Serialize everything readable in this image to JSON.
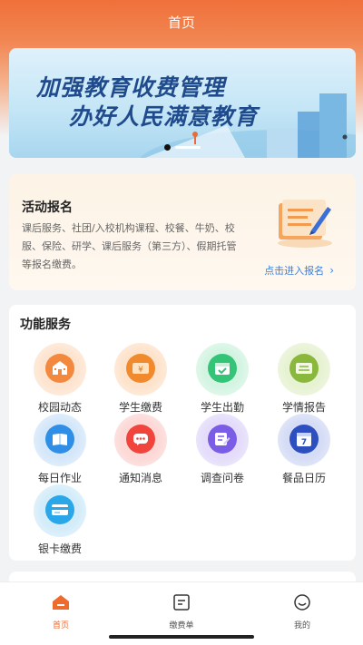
{
  "header": {
    "title": "首页"
  },
  "banner": {
    "line1": "加强教育收费管理",
    "line2": "办好人民满意教育"
  },
  "activity": {
    "title": "活动报名",
    "description": "课后服务、社团/入校机构课程、校餐、牛奶、校服、保险、研学、课后服务（第三方）、假期托管等报名缴费。",
    "link": "点击进入报名",
    "link_chevron": "›"
  },
  "services": {
    "title": "功能服务",
    "items": [
      {
        "label": "校园动态",
        "icon": "school-building-icon",
        "color": "#f2893e"
      },
      {
        "label": "学生缴费",
        "icon": "yuan-payment-icon",
        "color": "#f08a2c"
      },
      {
        "label": "学生出勤",
        "icon": "calendar-check-icon",
        "color": "#34c477"
      },
      {
        "label": "学情报告",
        "icon": "score-100-icon",
        "color": "#8ab83c"
      },
      {
        "label": "每日作业",
        "icon": "book-icon",
        "color": "#2f8fe6"
      },
      {
        "label": "通知消息",
        "icon": "message-icon",
        "color": "#f0443d"
      },
      {
        "label": "调查问卷",
        "icon": "survey-edit-icon",
        "color": "#7b5ce6"
      },
      {
        "label": "餐品日历",
        "icon": "calendar-7-icon",
        "color": "#2e4fbf"
      },
      {
        "label": "银卡缴费",
        "icon": "bank-card-icon",
        "color": "#2aa7e8"
      }
    ]
  },
  "calendar_day": "7",
  "yuan_symbol": "¥",
  "tabbar": {
    "items": [
      {
        "label": "首页",
        "active": true
      },
      {
        "label": "缴费单",
        "active": false
      },
      {
        "label": "我的",
        "active": false
      }
    ]
  },
  "colors": {
    "accent": "#ef6a2d",
    "link": "#3b7fe0"
  }
}
